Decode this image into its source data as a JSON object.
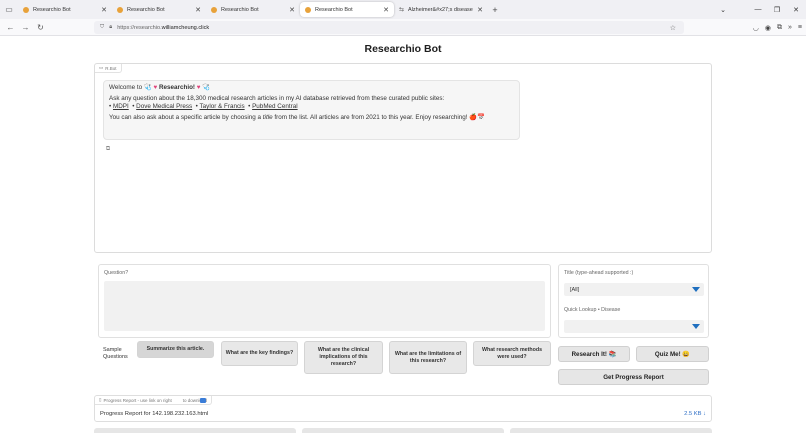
{
  "browser": {
    "tabs": [
      {
        "title": "Researchio Bot"
      },
      {
        "title": "Researchio Bot"
      },
      {
        "title": "Researchio Bot"
      },
      {
        "title": "Researchio Bot"
      },
      {
        "title": "Alzheimer&#x27;s disease c"
      }
    ],
    "url_prefix": "https://researchio.",
    "url_host": "williamcheung.click"
  },
  "page": {
    "title": "Researchio Bot"
  },
  "chat": {
    "label": "R.Bot",
    "welcome_pre": "Welcome to 🩺",
    "welcome_brand": "Researchio!",
    "welcome_post": "🩺",
    "ask_line": "Ask any question about the 18,300 medical research articles in my AI database retrieved from these curated public sites:",
    "sources": [
      "MDPI",
      "Dove Medical Press",
      "Taylor & Francis",
      "PubMed Central"
    ],
    "line3_pre": "You can also ask about a specific article by choosing a ",
    "line3_em": "title",
    "line3_post": " from the list. All articles are from 2021 to this year. Enjoy researching! 🍎📅"
  },
  "question": {
    "label": "Question?"
  },
  "filters": {
    "title_label": "Title  (type-ahead supported :)",
    "title_value": "[All]",
    "lookup_label": "Quick Lookup • Disease",
    "lookup_value": ""
  },
  "sample": {
    "label_line1": "Sample",
    "label_line2": "Questions",
    "buttons": [
      "Summarize this article.",
      "What are the key findings?",
      "What are the clinical implications of this research?",
      "What are the limitations of this research?",
      "What research methods were used?"
    ]
  },
  "actions": {
    "research": "Research It! 📚",
    "quiz": "Quiz Me! 😀",
    "progress": "Get Progress Report"
  },
  "report": {
    "label_pre": "Progress Report - use link on right",
    "label_post": "to download",
    "file_name": "Progress Report for 142.198.232.163.html",
    "file_size": "2.5 KB ↓"
  }
}
